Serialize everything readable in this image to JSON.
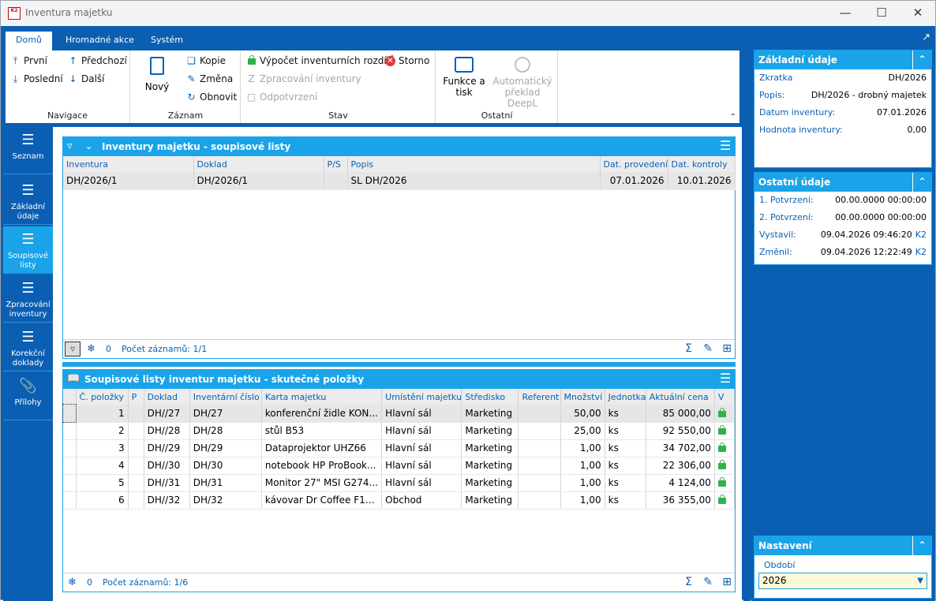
{
  "window": {
    "title": "Inventura majetku",
    "icon_text": "K2"
  },
  "ribbon": {
    "tabs": [
      "Domů",
      "Hromadné akce",
      "Systém"
    ],
    "navigace": {
      "label": "Navigace",
      "first": "První",
      "prev": "Předchozí",
      "last": "Poslední",
      "next": "Další"
    },
    "zaznam": {
      "label": "Záznam",
      "new": "Nový",
      "copy": "Kopie",
      "change": "Změna",
      "refresh": "Obnovit"
    },
    "stav": {
      "label": "Stav",
      "calc": "Výpočet inventurních rozdílů",
      "storno": "Storno",
      "process": "Zpracování inventury",
      "unconfirm": "Odpotvrzení"
    },
    "ostatni": {
      "label": "Ostatní",
      "functions_line1": "Funkce a",
      "functions_line2": "tisk",
      "deepl_line1": "Automatický",
      "deepl_line2": "překlad DeepL"
    }
  },
  "nav": {
    "items": [
      {
        "l1": "Seznam",
        "l2": ""
      },
      {
        "l1": "Základní",
        "l2": "údaje"
      },
      {
        "l1": "Soupisové",
        "l2": "listy"
      },
      {
        "l1": "Zpracování",
        "l2": "inventury"
      },
      {
        "l1": "Korekční",
        "l2": "doklady"
      },
      {
        "l1": "Přílohy",
        "l2": ""
      }
    ]
  },
  "top_section": {
    "title": "Inventury majetku - soupisové listy",
    "columns": [
      "Inventura",
      "Doklad",
      "P/S",
      "Popis",
      "Dat. provedení",
      "Dat. kontroly"
    ],
    "rows": [
      [
        "DH/2026/1",
        "DH/2026/1",
        "",
        "SL DH/2026",
        "07.01.2026",
        "10.01.2026"
      ]
    ],
    "footer_count": "0",
    "footer_records": "Počet záznamů: 1/1"
  },
  "bottom_section": {
    "title": "Soupisové listy inventur majetku - skutečné položky",
    "columns": [
      "Č. položky",
      "P",
      "Doklad",
      "Inventární číslo",
      "Karta majetku",
      "Umístění majetku",
      "Středisko",
      "Referent",
      "Množství",
      "Jednotka",
      "Aktuální cena",
      "V"
    ],
    "rows": [
      [
        "1",
        "",
        "DH//27",
        "DH/27",
        "konferenční židle KON...",
        "Hlavní sál",
        "Marketing",
        "",
        "50,00",
        "ks",
        "85 000,00"
      ],
      [
        "2",
        "",
        "DH//28",
        "DH/28",
        "stůl B53",
        "Hlavní sál",
        "Marketing",
        "",
        "25,00",
        "ks",
        "92 550,00"
      ],
      [
        "3",
        "",
        "DH//29",
        "DH/29",
        "Dataprojektor UHZ66",
        "Hlavní sál",
        "Marketing",
        "",
        "1,00",
        "ks",
        "34 702,00"
      ],
      [
        "4",
        "",
        "DH//30",
        "DH/30",
        "notebook HP ProBook...",
        "Hlavní sál",
        "Marketing",
        "",
        "1,00",
        "ks",
        "22 306,00"
      ],
      [
        "5",
        "",
        "DH//31",
        "DH/31",
        "Monitor 27\" MSI G274...",
        "Hlavní sál",
        "Marketing",
        "",
        "1,00",
        "ks",
        "4 124,00"
      ],
      [
        "6",
        "",
        "DH//32",
        "DH/32",
        "kávovar Dr Coffee F10...",
        "Obchod",
        "Marketing",
        "",
        "1,00",
        "ks",
        "36 355,00"
      ]
    ],
    "footer_count": "0",
    "footer_records": "Počet záznamů: 1/6"
  },
  "right": {
    "basic": {
      "title": "Základní údaje",
      "rows": [
        {
          "label": "Zkratka",
          "value": "DH/2026"
        },
        {
          "label": "Popis:",
          "value": "DH/2026 - drobný majetek"
        },
        {
          "label": "Datum inventury:",
          "value": "07.01.2026"
        },
        {
          "label": "Hodnota inventury:",
          "value": "0,00"
        }
      ]
    },
    "other": {
      "title": "Ostatní údaje",
      "rows": [
        {
          "label": "1. Potvrzení:",
          "value": "00.00.0000 00:00:00",
          "k2": ""
        },
        {
          "label": "2. Potvrzení:",
          "value": "00.00.0000 00:00:00",
          "k2": ""
        },
        {
          "label": "Vystavil:",
          "value": "09.04.2026 09:46:20",
          "k2": "K2"
        },
        {
          "label": "Změnil:",
          "value": "09.04.2026 12:22:49",
          "k2": "K2"
        }
      ]
    },
    "settings": {
      "title": "Nastavení",
      "period_label": "Období",
      "period_value": "2026"
    }
  }
}
